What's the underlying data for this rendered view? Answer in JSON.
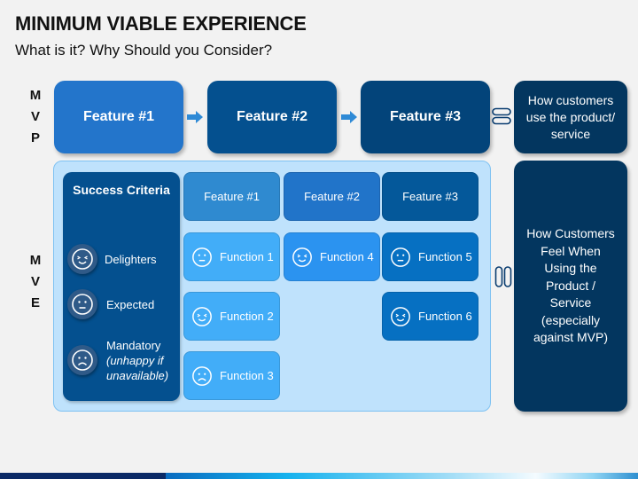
{
  "header": {
    "title": "MINIMUM VIABLE EXPERIENCE",
    "subtitle": "What is it? Why Should you Consider?"
  },
  "mvp": {
    "row_label": [
      "M",
      "V",
      "P"
    ],
    "features": [
      {
        "label": "Feature #1",
        "color": "#2375cb"
      },
      {
        "label": "Feature #2",
        "color": "#04508f"
      },
      {
        "label": "Feature #3",
        "color": "#03447a"
      }
    ],
    "outcome": "How customers use the product/ service",
    "outcome_color": "#03365f",
    "arrow_icon": "right-arrow-icon",
    "link_icon": "chain-link-icon"
  },
  "mve": {
    "row_label": [
      "M",
      "V",
      "E"
    ],
    "success_criteria": {
      "title": "Success Criteria",
      "items": [
        {
          "label": "Delighters",
          "icon": "delighted-face-icon"
        },
        {
          "label": "Expected",
          "icon": "neutral-face-icon"
        },
        {
          "label": "Mandatory",
          "note": "(unhappy if unavailable)",
          "icon": "sad-face-icon"
        }
      ]
    },
    "feature_headers": [
      {
        "label": "Feature #1",
        "color": "#2f8ad0"
      },
      {
        "label": "Feature #2",
        "color": "#2174c9"
      },
      {
        "label": "Feature #3",
        "color": "#04589a"
      }
    ],
    "functions": [
      {
        "label": "Function 1",
        "feature": 1,
        "icon": "neutral-face-icon",
        "color": "#42adf8"
      },
      {
        "label": "Function 2",
        "feature": 1,
        "icon": "delighted-face-icon",
        "color": "#42adf8"
      },
      {
        "label": "Function 3",
        "feature": 1,
        "icon": "sad-face-icon",
        "color": "#42adf8"
      },
      {
        "label": "Function 4",
        "feature": 2,
        "icon": "delighted-face-icon",
        "color": "#2b93f0"
      },
      {
        "label": "Function 5",
        "feature": 3,
        "icon": "neutral-face-icon",
        "color": "#0670c2"
      },
      {
        "label": "Function 6",
        "feature": 3,
        "icon": "delighted-face-icon",
        "color": "#0670c2"
      }
    ],
    "outcome": "How Customers Feel When Using the Product / Service (especially against MVP)",
    "outcome_color": "#03365f"
  }
}
